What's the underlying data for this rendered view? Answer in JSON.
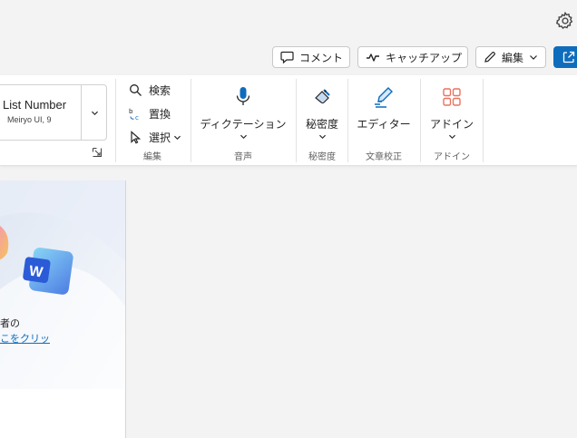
{
  "header": {
    "comment_label": "コメント",
    "catchup_label": "キャッチアップ",
    "edit_label": "編集"
  },
  "ribbon": {
    "style": {
      "name": "List Number",
      "font": "Meiryo UI, 9"
    },
    "editing": {
      "find_label": "検索",
      "replace_label": "置換",
      "select_label": "選択",
      "group_label": "編集"
    },
    "voice": {
      "dictate_label": "ディクテーション",
      "group_label": "音声"
    },
    "sensitivity": {
      "label": "秘密度",
      "group_label": "秘密度"
    },
    "proofing": {
      "editor_label": "エディター",
      "group_label": "文章校正"
    },
    "addins": {
      "label": "アドイン",
      "group_label": "アドイン"
    }
  },
  "document": {
    "text_line": "者の",
    "link_text": "こをクリッ"
  },
  "colors": {
    "accent": "#0f6cbd",
    "addin_icon": "#e8735f"
  }
}
